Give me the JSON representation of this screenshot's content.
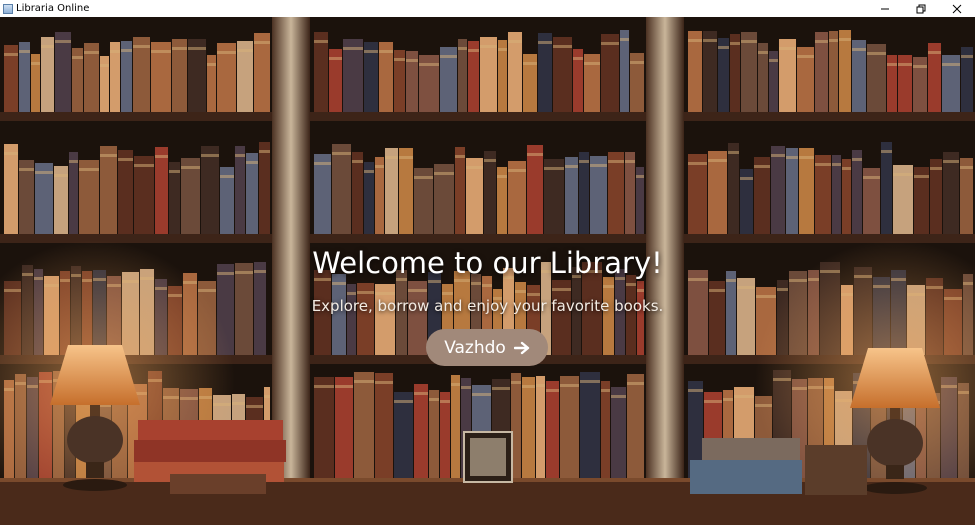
{
  "window": {
    "title": "Libraria Online",
    "controls": [
      "minimize-icon",
      "restore-icon",
      "close-icon"
    ]
  },
  "hero": {
    "title": "Welcome to our Library!",
    "subtitle": "Explore, borrow and enjoy your favorite books.",
    "cta_label": "Vazhdo",
    "cta_icon": "arrow-right-icon"
  },
  "colors": {
    "cta_bg": "#a1897a",
    "text": "#ffffff",
    "shelf_wood": "#3d2418"
  }
}
